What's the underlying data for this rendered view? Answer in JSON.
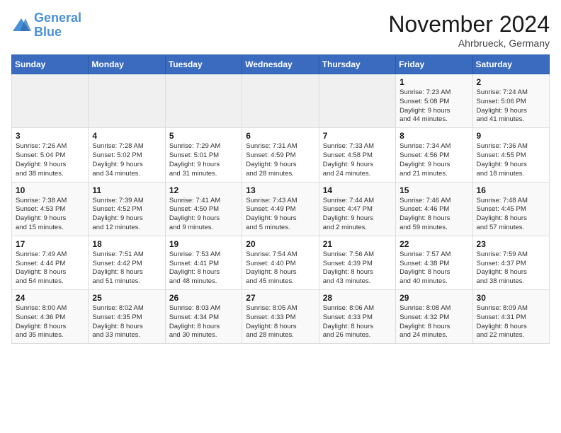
{
  "logo": {
    "line1": "General",
    "line2": "Blue"
  },
  "title": "November 2024",
  "location": "Ahrbrueck, Germany",
  "days_of_week": [
    "Sunday",
    "Monday",
    "Tuesday",
    "Wednesday",
    "Thursday",
    "Friday",
    "Saturday"
  ],
  "weeks": [
    [
      {
        "day": "",
        "info": ""
      },
      {
        "day": "",
        "info": ""
      },
      {
        "day": "",
        "info": ""
      },
      {
        "day": "",
        "info": ""
      },
      {
        "day": "",
        "info": ""
      },
      {
        "day": "1",
        "info": "Sunrise: 7:23 AM\nSunset: 5:08 PM\nDaylight: 9 hours\nand 44 minutes."
      },
      {
        "day": "2",
        "info": "Sunrise: 7:24 AM\nSunset: 5:06 PM\nDaylight: 9 hours\nand 41 minutes."
      }
    ],
    [
      {
        "day": "3",
        "info": "Sunrise: 7:26 AM\nSunset: 5:04 PM\nDaylight: 9 hours\nand 38 minutes."
      },
      {
        "day": "4",
        "info": "Sunrise: 7:28 AM\nSunset: 5:02 PM\nDaylight: 9 hours\nand 34 minutes."
      },
      {
        "day": "5",
        "info": "Sunrise: 7:29 AM\nSunset: 5:01 PM\nDaylight: 9 hours\nand 31 minutes."
      },
      {
        "day": "6",
        "info": "Sunrise: 7:31 AM\nSunset: 4:59 PM\nDaylight: 9 hours\nand 28 minutes."
      },
      {
        "day": "7",
        "info": "Sunrise: 7:33 AM\nSunset: 4:58 PM\nDaylight: 9 hours\nand 24 minutes."
      },
      {
        "day": "8",
        "info": "Sunrise: 7:34 AM\nSunset: 4:56 PM\nDaylight: 9 hours\nand 21 minutes."
      },
      {
        "day": "9",
        "info": "Sunrise: 7:36 AM\nSunset: 4:55 PM\nDaylight: 9 hours\nand 18 minutes."
      }
    ],
    [
      {
        "day": "10",
        "info": "Sunrise: 7:38 AM\nSunset: 4:53 PM\nDaylight: 9 hours\nand 15 minutes."
      },
      {
        "day": "11",
        "info": "Sunrise: 7:39 AM\nSunset: 4:52 PM\nDaylight: 9 hours\nand 12 minutes."
      },
      {
        "day": "12",
        "info": "Sunrise: 7:41 AM\nSunset: 4:50 PM\nDaylight: 9 hours\nand 9 minutes."
      },
      {
        "day": "13",
        "info": "Sunrise: 7:43 AM\nSunset: 4:49 PM\nDaylight: 9 hours\nand 5 minutes."
      },
      {
        "day": "14",
        "info": "Sunrise: 7:44 AM\nSunset: 4:47 PM\nDaylight: 9 hours\nand 2 minutes."
      },
      {
        "day": "15",
        "info": "Sunrise: 7:46 AM\nSunset: 4:46 PM\nDaylight: 8 hours\nand 59 minutes."
      },
      {
        "day": "16",
        "info": "Sunrise: 7:48 AM\nSunset: 4:45 PM\nDaylight: 8 hours\nand 57 minutes."
      }
    ],
    [
      {
        "day": "17",
        "info": "Sunrise: 7:49 AM\nSunset: 4:44 PM\nDaylight: 8 hours\nand 54 minutes."
      },
      {
        "day": "18",
        "info": "Sunrise: 7:51 AM\nSunset: 4:42 PM\nDaylight: 8 hours\nand 51 minutes."
      },
      {
        "day": "19",
        "info": "Sunrise: 7:53 AM\nSunset: 4:41 PM\nDaylight: 8 hours\nand 48 minutes."
      },
      {
        "day": "20",
        "info": "Sunrise: 7:54 AM\nSunset: 4:40 PM\nDaylight: 8 hours\nand 45 minutes."
      },
      {
        "day": "21",
        "info": "Sunrise: 7:56 AM\nSunset: 4:39 PM\nDaylight: 8 hours\nand 43 minutes."
      },
      {
        "day": "22",
        "info": "Sunrise: 7:57 AM\nSunset: 4:38 PM\nDaylight: 8 hours\nand 40 minutes."
      },
      {
        "day": "23",
        "info": "Sunrise: 7:59 AM\nSunset: 4:37 PM\nDaylight: 8 hours\nand 38 minutes."
      }
    ],
    [
      {
        "day": "24",
        "info": "Sunrise: 8:00 AM\nSunset: 4:36 PM\nDaylight: 8 hours\nand 35 minutes."
      },
      {
        "day": "25",
        "info": "Sunrise: 8:02 AM\nSunset: 4:35 PM\nDaylight: 8 hours\nand 33 minutes."
      },
      {
        "day": "26",
        "info": "Sunrise: 8:03 AM\nSunset: 4:34 PM\nDaylight: 8 hours\nand 30 minutes."
      },
      {
        "day": "27",
        "info": "Sunrise: 8:05 AM\nSunset: 4:33 PM\nDaylight: 8 hours\nand 28 minutes."
      },
      {
        "day": "28",
        "info": "Sunrise: 8:06 AM\nSunset: 4:33 PM\nDaylight: 8 hours\nand 26 minutes."
      },
      {
        "day": "29",
        "info": "Sunrise: 8:08 AM\nSunset: 4:32 PM\nDaylight: 8 hours\nand 24 minutes."
      },
      {
        "day": "30",
        "info": "Sunrise: 8:09 AM\nSunset: 4:31 PM\nDaylight: 8 hours\nand 22 minutes."
      }
    ]
  ]
}
